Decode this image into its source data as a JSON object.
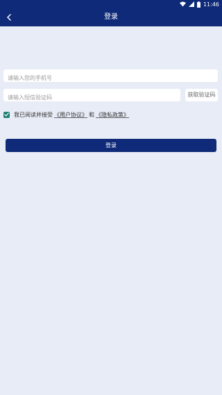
{
  "status_bar": {
    "time": "11:46",
    "icons": [
      "wifi-icon",
      "signal-icon",
      "battery-icon"
    ]
  },
  "header": {
    "title": "登录",
    "back_icon": "chevron-left-icon"
  },
  "form": {
    "phone_placeholder": "请输入您的手机号",
    "phone_value": "",
    "sms_placeholder": "请输入短信验证码",
    "sms_value": "",
    "get_code_label": "获取验证码"
  },
  "agreement": {
    "checked": true,
    "prefix": "我已阅读并接受",
    "user_agreement": "《用户协议》",
    "conjunction": "和",
    "privacy_policy": "《隐私政策》"
  },
  "login_button": "登录",
  "colors": {
    "primary": "#0e2a78",
    "background": "#e8ecf6",
    "checkbox": "#1e7f74"
  }
}
